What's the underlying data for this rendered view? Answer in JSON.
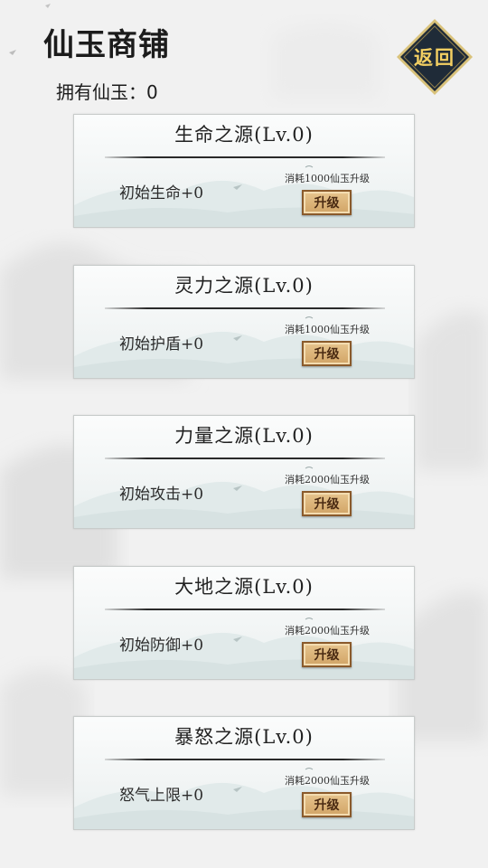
{
  "header": {
    "title": "仙玉商铺",
    "jade_owned_label": "拥有仙玉：0",
    "back_label": "返回"
  },
  "colors": {
    "back_button_bg": "#1f2b38",
    "back_button_border": "#d9c27a",
    "back_button_text": "#f3cf62",
    "upgrade_button_bg": "#dbb478",
    "upgrade_button_border": "#8a5a2b"
  },
  "upgrades": [
    {
      "title": "生命之源(Lv.0)",
      "stat": "初始生命+0",
      "cost": "消耗1000仙玉升级",
      "button": "升级"
    },
    {
      "title": "灵力之源(Lv.0)",
      "stat": "初始护盾+0",
      "cost": "消耗1000仙玉升级",
      "button": "升级"
    },
    {
      "title": "力量之源(Lv.0)",
      "stat": "初始攻击+0",
      "cost": "消耗2000仙玉升级",
      "button": "升级"
    },
    {
      "title": "大地之源(Lv.0)",
      "stat": "初始防御+0",
      "cost": "消耗2000仙玉升级",
      "button": "升级"
    },
    {
      "title": "暴怒之源(Lv.0)",
      "stat": "怒气上限+0",
      "cost": "消耗2000仙玉升级",
      "button": "升级"
    }
  ]
}
